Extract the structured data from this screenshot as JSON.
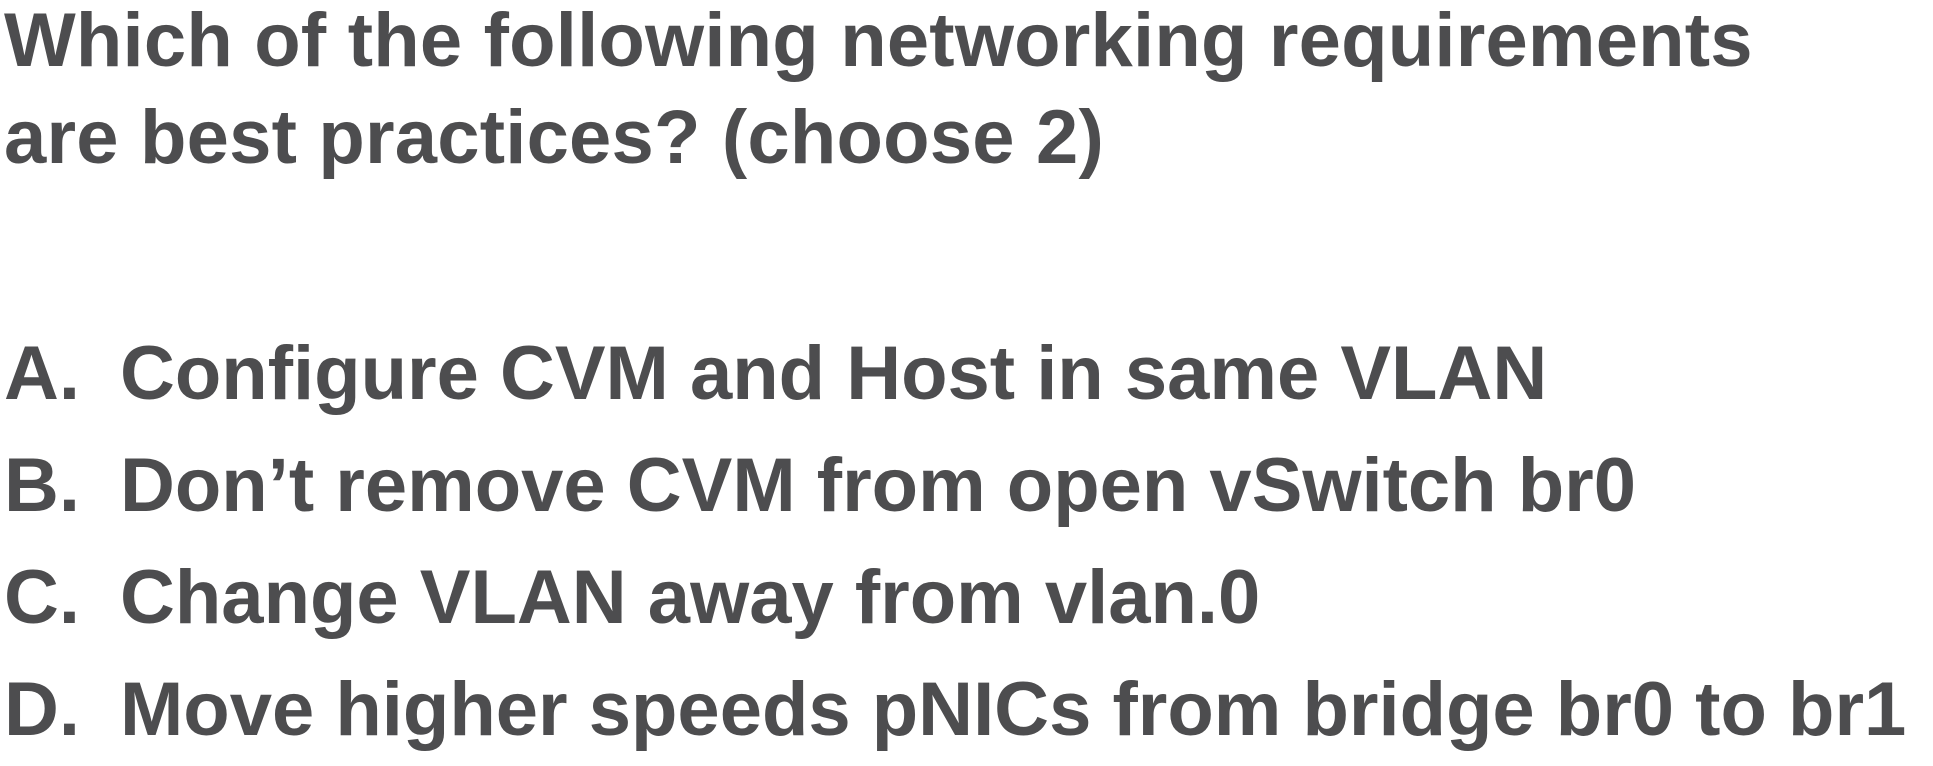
{
  "question": {
    "line1": "Which of the following networking requirements",
    "line2": "are best practices? (choose 2)"
  },
  "options": [
    {
      "letter": "A.",
      "text": "Configure CVM and Host in same VLAN"
    },
    {
      "letter": "B.",
      "text": "Don’t remove CVM from open vSwitch br0"
    },
    {
      "letter": "C.",
      "text": "Change VLAN away from vlan.0"
    },
    {
      "letter": "D.",
      "text": "Move higher speeds pNICs from bridge br0 to br1"
    }
  ],
  "colors": {
    "text": "#4d4d4f",
    "background": "#ffffff"
  }
}
